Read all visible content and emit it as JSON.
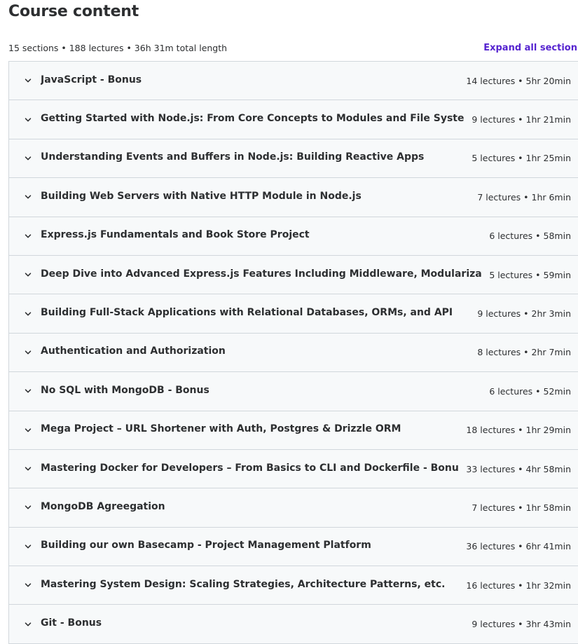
{
  "header": {
    "title": "Course content",
    "summary": "15 sections • 188 lectures • 36h 31m total length",
    "expand_label": "Expand all section"
  },
  "sections": [
    {
      "title": "JavaScript - Bonus",
      "meta": "14 lectures • 5hr 20min"
    },
    {
      "title": "Getting Started with Node.js: From Core Concepts to Modules and File System",
      "meta": "9 lectures • 1hr 21min"
    },
    {
      "title": "Understanding Events and Buffers in Node.js: Building Reactive Apps",
      "meta": "5 lectures • 1hr 25min"
    },
    {
      "title": "Building Web Servers with Native HTTP Module in Node.js",
      "meta": "7 lectures • 1hr 6min"
    },
    {
      "title": "Express.js Fundamentals and Book Store Project",
      "meta": "6 lectures • 58min"
    },
    {
      "title": "Deep Dive into Advanced Express.js Features Including Middleware, Modularization",
      "meta": "5 lectures • 59min"
    },
    {
      "title": "Building Full-Stack Applications with Relational Databases, ORMs, and API",
      "meta": "9 lectures • 2hr 3min"
    },
    {
      "title": "Authentication and Authorization",
      "meta": "8 lectures • 2hr 7min"
    },
    {
      "title": "No SQL with MongoDB - Bonus",
      "meta": "6 lectures • 52min"
    },
    {
      "title": "Mega Project – URL Shortener with Auth, Postgres & Drizzle ORM",
      "meta": "18 lectures • 1hr 29min"
    },
    {
      "title": "Mastering Docker for Developers – From Basics to CLI and Dockerfile - Bonus",
      "meta": "33 lectures • 4hr 58min"
    },
    {
      "title": "MongoDB Agreegation",
      "meta": "7 lectures • 1hr 58min"
    },
    {
      "title": "Building our own Basecamp - Project Management Platform",
      "meta": "36 lectures • 6hr 41min"
    },
    {
      "title": "Mastering System Design: Scaling Strategies, Architecture Patterns, etc.",
      "meta": "16 lectures • 1hr 32min"
    },
    {
      "title": "Git - Bonus",
      "meta": "9 lectures • 3hr 43min"
    }
  ],
  "icons": {
    "section_toggle": "chevron-down-icon"
  },
  "colors": {
    "accent": "#5624d0",
    "row_bg": "#f7f9fa",
    "border": "#d1d7dc",
    "text": "#2d2f31"
  }
}
